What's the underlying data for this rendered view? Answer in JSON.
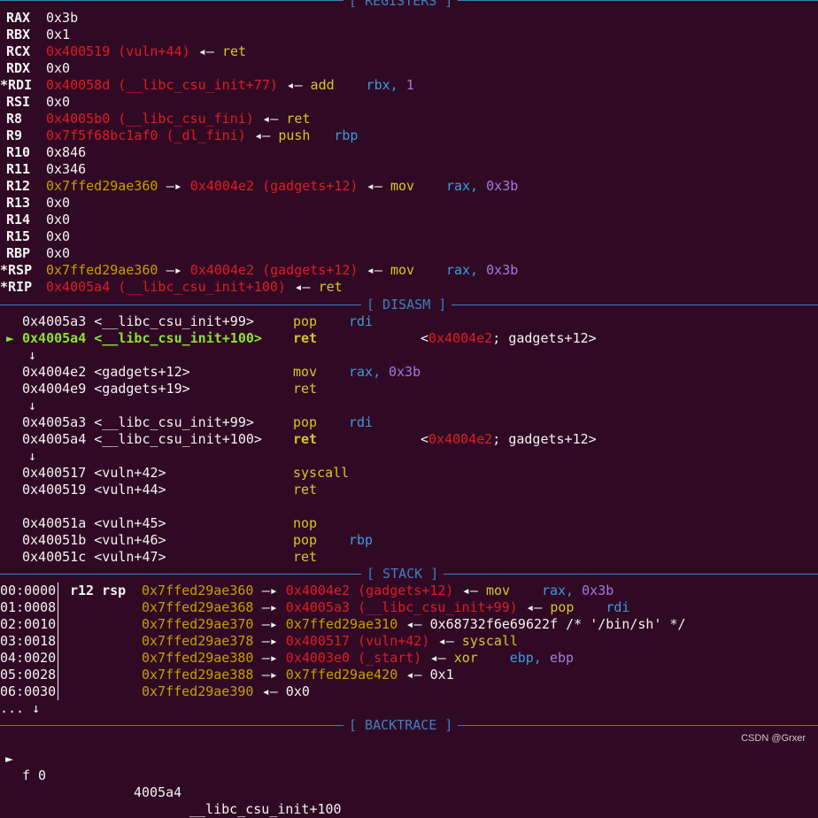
{
  "headers": {
    "registers": "[ REGISTERS ]",
    "disasm": "[ DISASM ]",
    "stack": "[ STACK ]",
    "backtrace": "[ BACKTRACE ]"
  },
  "registers": [
    {
      "name": "RAX",
      "value": "0x3b"
    },
    {
      "name": "RBX",
      "value": "0x1"
    },
    {
      "name": "RCX",
      "value": "0x400519 (vuln+44)",
      "arrow": "◂—",
      "insn": "ret"
    },
    {
      "name": "RDX",
      "value": "0x0"
    },
    {
      "name": "*RDI",
      "value": "0x40058d (__libc_csu_init+77)",
      "arrow": "◂—",
      "insn": "add",
      "op1": "rbx,",
      "op2": "1"
    },
    {
      "name": "RSI",
      "value": "0x0"
    },
    {
      "name": "R8",
      "value": "0x4005b0 (__libc_csu_fini)",
      "arrow": "◂—",
      "insn": "ret"
    },
    {
      "name": "R9",
      "value": "0x7f5f68bc1af0 (_dl_fini)",
      "arrow": "◂—",
      "insn": "push",
      "op1": "rbp"
    },
    {
      "name": "R10",
      "value": "0x846"
    },
    {
      "name": "R11",
      "value": "0x346"
    },
    {
      "name": "R12",
      "ptr": "0x7ffed29ae360",
      "arrow1": "—▸",
      "value": "0x4004e2 (gadgets+12)",
      "arrow": "◂—",
      "insn": "mov",
      "op1": "rax,",
      "op2": "0x3b"
    },
    {
      "name": "R13",
      "value": "0x0"
    },
    {
      "name": "R14",
      "value": "0x0"
    },
    {
      "name": "R15",
      "value": "0x0"
    },
    {
      "name": "RBP",
      "value": "0x0"
    },
    {
      "name": "*RSP",
      "ptr": "0x7ffed29ae360",
      "arrow1": "—▸",
      "value": "0x4004e2 (gadgets+12)",
      "arrow": "◂—",
      "insn": "mov",
      "op1": "rax,",
      "op2": "0x3b"
    },
    {
      "name": "*RIP",
      "value": "0x4005a4 (__libc_csu_init+100)",
      "arrow": "◂—",
      "insn": "ret"
    }
  ],
  "disasm": [
    {
      "marker": "",
      "addr": "0x4005a3 <__libc_csu_init+99>",
      "insn": "pop",
      "op": "rdi",
      "current": false
    },
    {
      "marker": "►",
      "addr": "0x4005a4 <__libc_csu_init+100>",
      "insn": "ret",
      "current": true,
      "comment": "<0x4004e2; gadgets+12>"
    },
    {
      "jump": "↓"
    },
    {
      "marker": "",
      "addr": "0x4004e2 <gadgets+12>",
      "insn": "mov",
      "op": "rax,",
      "op2": "0x3b"
    },
    {
      "marker": "",
      "addr": "0x4004e9 <gadgets+19>",
      "insn": "ret"
    },
    {
      "jump": "↓"
    },
    {
      "marker": "",
      "addr": "0x4005a3 <__libc_csu_init+99>",
      "insn": "pop",
      "op": "rdi"
    },
    {
      "marker": "",
      "addr": "0x4005a4 <__libc_csu_init+100>",
      "insn": "ret",
      "bold": true,
      "comment": "<0x4004e2; gadgets+12>"
    },
    {
      "jump": "↓"
    },
    {
      "marker": "",
      "addr": "0x400517 <vuln+42>",
      "insn": "syscall"
    },
    {
      "marker": "",
      "addr": "0x400519 <vuln+44>",
      "insn": "ret"
    },
    {
      "blank": true
    },
    {
      "marker": "",
      "addr": "0x40051a <vuln+45>",
      "insn": "nop"
    },
    {
      "marker": "",
      "addr": "0x40051b <vuln+46>",
      "insn": "pop",
      "op": "rbp"
    },
    {
      "marker": "",
      "addr": "0x40051c <vuln+47>",
      "insn": "ret"
    }
  ],
  "stack": [
    {
      "idx": "00:0000",
      "regs": "r12 rsp",
      "addr": "0x7ffed29ae360",
      "arrow1": "—▸",
      "val": "0x4004e2 (gadgets+12)",
      "arrow2": "◂—",
      "insn": "mov",
      "op": "rax,",
      "op2": "0x3b"
    },
    {
      "idx": "01:0008",
      "regs": "",
      "addr": "0x7ffed29ae368",
      "arrow1": "—▸",
      "val": "0x4005a3 (__libc_csu_init+99)",
      "arrow2": "◂—",
      "insn": "pop",
      "op": "rdi"
    },
    {
      "idx": "02:0010",
      "regs": "",
      "addr": "0x7ffed29ae370",
      "arrow1": "—▸",
      "val2": "0x7ffed29ae310",
      "arrow2": "◂—",
      "tail": "0x68732f6e69622f /* '/bin/sh' */"
    },
    {
      "idx": "03:0018",
      "regs": "",
      "addr": "0x7ffed29ae378",
      "arrow1": "—▸",
      "val": "0x400517 (vuln+42)",
      "arrow2": "◂—",
      "insn": "syscall"
    },
    {
      "idx": "04:0020",
      "regs": "",
      "addr": "0x7ffed29ae380",
      "arrow1": "—▸",
      "val": "0x4003e0 (_start)",
      "arrow2": "◂—",
      "insn": "xor",
      "op": "ebp,",
      "op2": "ebp"
    },
    {
      "idx": "05:0028",
      "regs": "",
      "addr": "0x7ffed29ae388",
      "arrow1": "—▸",
      "val2": "0x7ffed29ae420",
      "arrow2": "◂—",
      "tail": "0x1"
    },
    {
      "idx": "06:0030",
      "regs": "",
      "addr": "0x7ffed29ae390",
      "arrow2": "◂—",
      "tail": "0x0"
    }
  ],
  "stack_more": "... ↓",
  "backtrace": {
    "marker": "►",
    "frame": "f 0",
    "addr": "4005a4",
    "sym": "__libc_csu_init+100"
  },
  "watermark": "CSDN @Grxer"
}
